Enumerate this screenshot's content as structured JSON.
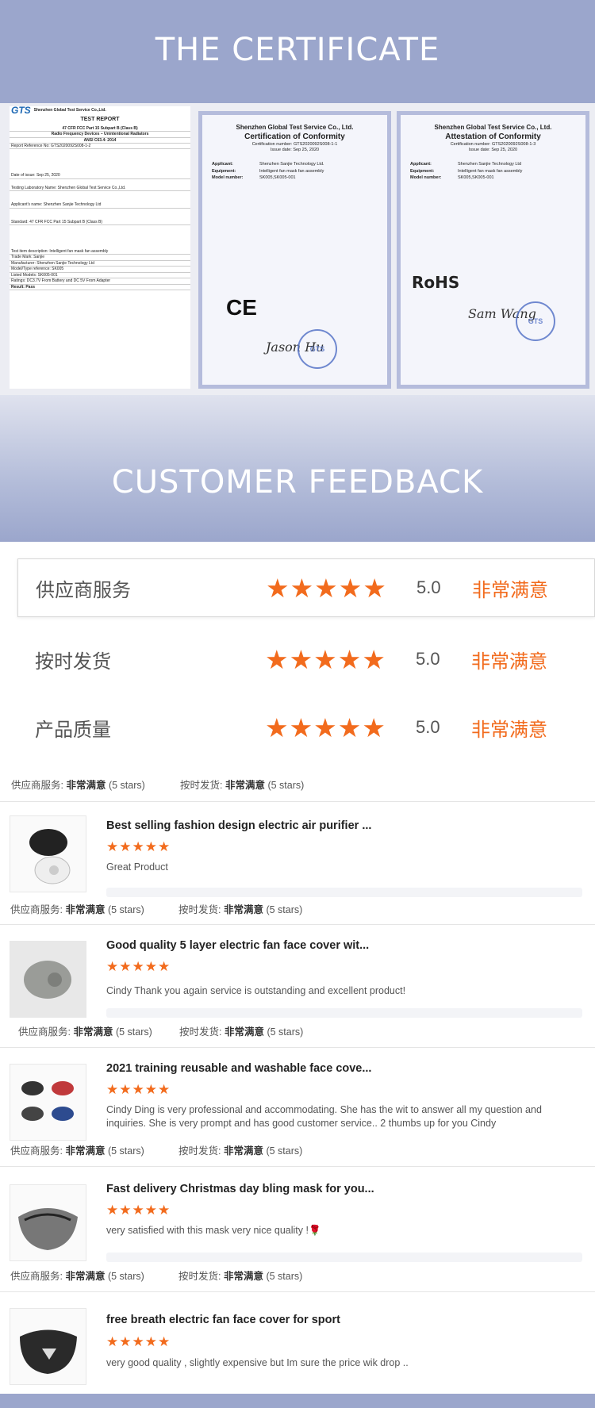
{
  "header": {
    "certificate_title": "THE CERTIFICATE",
    "feedback_title": "CUSTOMER FEEDBACK"
  },
  "report": {
    "company": "Shenzhen Global Test Service Co.,Ltd.",
    "logo": "GTS",
    "title": "TEST REPORT",
    "lines": [
      "47 CFR FCC Part 15 Subpart B (Class B)",
      "Radio Frequency Devices – Unintentional Radiators",
      "ANSI C63.4: 2014",
      "Report Reference No: GTS2020092S008-1-2",
      "Date of issue: Sep 25, 2020",
      "Testing Laboratory Name: Shenzhen Global Test Service Co.,Ltd.",
      "Applicant's name: Shenzhen Sanjie Technology Ltd",
      "Standard: 47 CFR FCC Part 15 Subpart B (Class B)",
      "Test item description: Intelligent fan mask fan assembly",
      "Trade Mark: Sanjie",
      "Manufacturer: Shenzhen Sanjie Technology Ltd",
      "Model/Type reference: SK005",
      "Listed Models: SK005-001",
      "Ratings: DC3.7V From Battery and DC 5V From Adapter",
      "Result: Pass"
    ]
  },
  "cert1": {
    "company": "Shenzhen Global Test Service Co., Ltd.",
    "title": "Certification of Conformity",
    "number": "Certification number: GTS2020092S008-1-1",
    "date": "Issue date: Sep 25, 2020",
    "applicant": "Shenzhen Sanjie Technology Ltd.",
    "equipment": "Intelligent fan mask fan assembly",
    "model": "SK005,SK005-001",
    "mark": "CE",
    "signature": "Jason Hu"
  },
  "cert2": {
    "company": "Shenzhen Global Test Service Co., Ltd.",
    "title": "Attestation of Conformity",
    "number": "Certification number: GTS2020092S008-1-3",
    "date": "Issue date: Sep 25, 2020",
    "applicant": "Shenzhen Sanjie Technology Ltd",
    "equipment": "Intelligent fan mask fan assembly",
    "model": "SK005,SK005-001",
    "mark": "RoHS",
    "signature": "Sam Wang",
    "stamp": "GTS"
  },
  "ratings": [
    {
      "label": "供应商服务",
      "stars": "★★★★★",
      "score": "5.0",
      "text": "非常满意"
    },
    {
      "label": "按时发货",
      "stars": "★★★★★",
      "score": "5.0",
      "text": "非常满意"
    },
    {
      "label": "产品质量",
      "stars": "★★★★★",
      "score": "5.0",
      "text": "非常满意"
    }
  ],
  "summary": {
    "service_label": "供应商服务:",
    "service_value": "非常满意",
    "service_stars": "(5 stars)",
    "shipping_label": "按时发货:",
    "shipping_value": "非常满意",
    "shipping_stars": "(5 stars)"
  },
  "reviews": [
    {
      "title": "Best selling fashion design electric air purifier ...",
      "stars": "★★★★★",
      "text": "Great Product"
    },
    {
      "title": "Good quality 5 layer electric fan face cover wit...",
      "stars": "★★★★★",
      "text": "Cindy Thank you again service is outstanding and excellent product!"
    },
    {
      "title": "2021 training reusable and washable face cove...",
      "stars": "★★★★★",
      "text": "Cindy Ding is very professional and accommodating. She has the wit to answer all my question and inquiries. She is very prompt and has good customer service.. 2 thumbs up for you Cindy"
    },
    {
      "title": "Fast delivery Christmas day bling mask for you...",
      "stars": "★★★★★",
      "text": "very satisfied with this mask very nice quality !🌹"
    },
    {
      "title": "free breath electric fan face cover for sport",
      "stars": "★★★★★",
      "text": "very good quality , slightly expensive but Im sure the price wik drop .."
    }
  ],
  "colors": {
    "band": "#9ba6cc",
    "accent": "#f26b1d"
  }
}
